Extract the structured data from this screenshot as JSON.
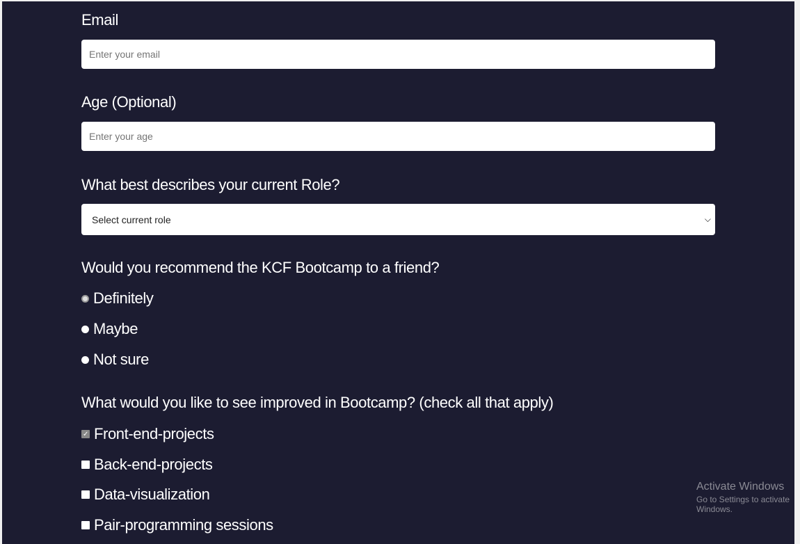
{
  "form": {
    "email": {
      "label": "Email",
      "placeholder": "Enter your email"
    },
    "age": {
      "label": "Age (Optional)",
      "placeholder": "Enter your age"
    },
    "role": {
      "label": "What best describes your current Role?",
      "selected": "Select current role"
    },
    "recommend": {
      "label": "Would you recommend the KCF Bootcamp to a friend?",
      "options": [
        {
          "label": "Definitely",
          "checked": true
        },
        {
          "label": "Maybe",
          "checked": false
        },
        {
          "label": "Not sure",
          "checked": false
        }
      ]
    },
    "improve": {
      "label": "What would you like to see improved in Bootcamp? (check all that apply)",
      "options": [
        {
          "label": "Front-end-projects",
          "checked": true
        },
        {
          "label": "Back-end-projects",
          "checked": false
        },
        {
          "label": "Data-visualization",
          "checked": false
        },
        {
          "label": "Pair-programming sessions",
          "checked": false
        }
      ]
    }
  },
  "watermark": {
    "title": "Activate Windows",
    "subtitle": "Go to Settings to activate Windows."
  }
}
